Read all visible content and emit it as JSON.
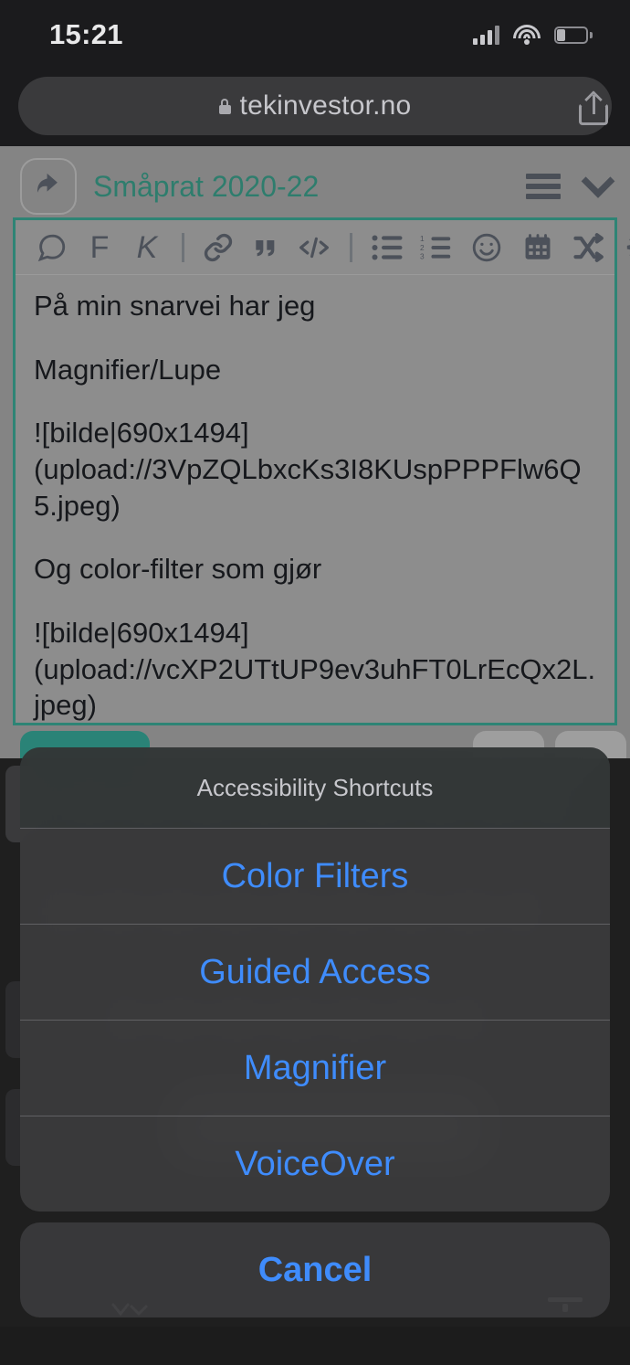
{
  "status_bar": {
    "time": "15:21",
    "cellular_icon": "cellular-signal-icon",
    "wifi_icon": "wifi-icon",
    "battery_icon": "battery-low-icon",
    "battery_level_pct": 20
  },
  "browser": {
    "url": "tekinvestor.no",
    "lock_icon": "lock-icon",
    "share_icon": "share-icon"
  },
  "forum": {
    "reply_icon": "reply-arrow-icon",
    "topic_title": "Småprat 2020-22",
    "menu_icon": "hamburger-menu-icon",
    "collapse_icon": "chevron-down-icon",
    "accent_color": "#2e7d6d",
    "editor_border_color": "#2e8475",
    "toolbar": [
      {
        "name": "quote-bubble-icon",
        "label": ""
      },
      {
        "name": "bold-icon",
        "label": "F"
      },
      {
        "name": "italic-icon",
        "label": "K"
      },
      {
        "name": "link-icon",
        "label": ""
      },
      {
        "name": "blockquote-icon",
        "label": ""
      },
      {
        "name": "code-icon",
        "label": ""
      },
      {
        "name": "bulleted-list-icon",
        "label": ""
      },
      {
        "name": "numbered-list-icon",
        "label": ""
      },
      {
        "name": "emoji-icon",
        "label": ""
      },
      {
        "name": "calendar-icon",
        "label": ""
      },
      {
        "name": "shuffle-icon",
        "label": ""
      },
      {
        "name": "gear-icon",
        "label": ""
      }
    ],
    "composer": {
      "line1": "På min snarvei har jeg",
      "line2": "Magnifier/Lupe",
      "line3": "![bilde|690x1494](upload://3VpZQLbxcKs3I8KUspPPPFlw6Q5.jpeg)",
      "line4": "Og color-filter som gjør",
      "line5": "![bilde|690x1494](upload://vcXP2UTtUP9ev3uhFT0LrEcQx2L.jpeg)"
    }
  },
  "action_sheet": {
    "title": "Accessibility Shortcuts",
    "items": [
      {
        "label": "Color Filters"
      },
      {
        "label": "Guided Access"
      },
      {
        "label": "Magnifier"
      },
      {
        "label": "VoiceOver"
      }
    ],
    "cancel_label": "Cancel",
    "tint_color": "#3f8cfc"
  }
}
